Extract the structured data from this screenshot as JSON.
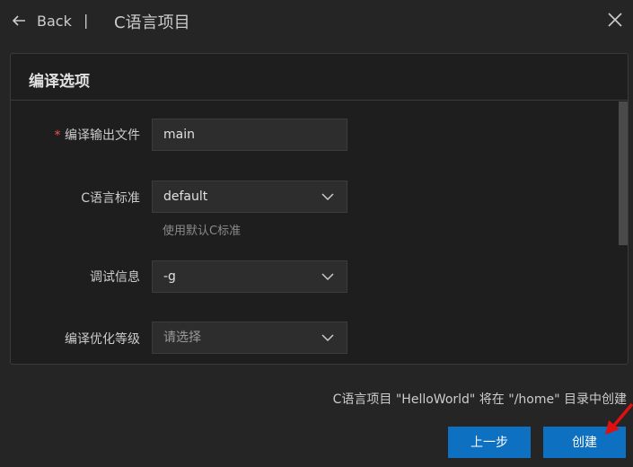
{
  "header": {
    "back_icon": "arrow-left-icon",
    "back_label": "Back",
    "separator": "|",
    "title": "C语言项目",
    "close_icon": "close-icon"
  },
  "panel": {
    "title": "编译选项",
    "fields": [
      {
        "required_mark": "*",
        "label": "编译输出文件",
        "value": "main",
        "type": "text"
      },
      {
        "label": "C语言标准",
        "value": "default",
        "type": "select",
        "hint": "使用默认C标准"
      },
      {
        "label": "调试信息",
        "value": "-g",
        "type": "select"
      },
      {
        "label": "编译优化等级",
        "placeholder": "请选择",
        "type": "select"
      }
    ]
  },
  "footer": {
    "note": "C语言项目 \"HelloWorld\" 将在 \"/home\" 目录中创建",
    "prev_button": "上一步",
    "create_button": "创建"
  },
  "colors": {
    "accent": "#0e70c0",
    "required": "#e55353",
    "annotation_arrow": "#e01010"
  }
}
